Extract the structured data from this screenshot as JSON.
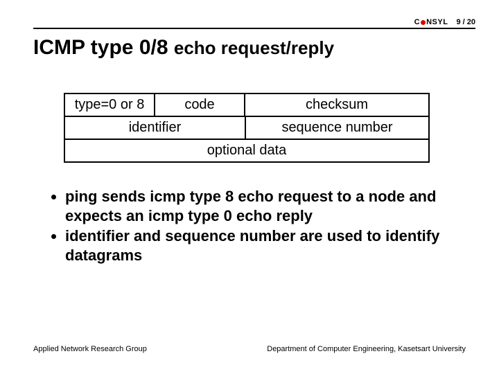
{
  "header": {
    "logo_text_left": "C",
    "logo_text_right": "NSYL",
    "page_current": "9",
    "page_sep": "/",
    "page_total": "20"
  },
  "title": {
    "main": "ICMP type 0/8 ",
    "sub": "echo request/reply"
  },
  "packet": {
    "row1": {
      "type": "type=0 or 8",
      "code": "code",
      "checksum": "checksum"
    },
    "row2": {
      "identifier": "identifier",
      "seq": "sequence number"
    },
    "row3": {
      "data": "optional data"
    }
  },
  "bullets": [
    "ping sends icmp type 8 echo request to a node and expects an icmp type 0 echo reply",
    "identifier and sequence number are used to identify datagrams"
  ],
  "footer": {
    "left": "Applied Network Research Group",
    "right": "Department of Computer Engineering, Kasetsart University"
  }
}
